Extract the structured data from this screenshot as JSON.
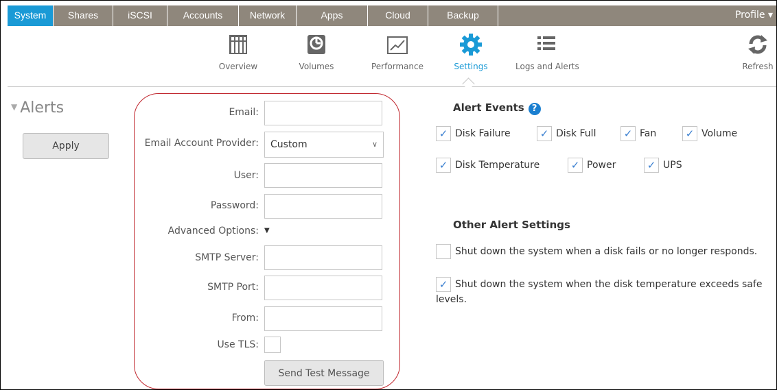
{
  "topnav": {
    "tabs": [
      {
        "label": "System",
        "active": true
      },
      {
        "label": "Shares"
      },
      {
        "label": "iSCSI"
      },
      {
        "label": "Accounts"
      },
      {
        "label": "Network"
      },
      {
        "label": "Apps"
      },
      {
        "label": "Cloud"
      },
      {
        "label": "Backup"
      }
    ],
    "profile": "Profile ▾"
  },
  "subnav": {
    "items": [
      {
        "label": "Overview",
        "icon": "overview-icon"
      },
      {
        "label": "Volumes",
        "icon": "volumes-icon"
      },
      {
        "label": "Performance",
        "icon": "performance-icon"
      },
      {
        "label": "Settings",
        "icon": "settings-icon",
        "active": true
      },
      {
        "label": "Logs and Alerts",
        "icon": "logs-icon"
      }
    ],
    "refresh": "Refresh"
  },
  "section": {
    "title": "Alerts",
    "apply": "Apply"
  },
  "form": {
    "email_label": "Email:",
    "email_value": "",
    "provider_label": "Email Account Provider:",
    "provider_value": "Custom",
    "user_label": "User:",
    "password_label": "Password:",
    "advanced_label": "Advanced Options:",
    "advanced_arrow": "▼",
    "smtp_server_label": "SMTP Server:",
    "smtp_port_label": "SMTP Port:",
    "from_label": "From:",
    "tls_label": "Use TLS:",
    "send_button": "Send Test Message"
  },
  "alert_events": {
    "title": "Alert Events",
    "help": "?",
    "items": [
      {
        "label": "Disk Failure",
        "checked": true
      },
      {
        "label": "Disk Full",
        "checked": true
      },
      {
        "label": "Fan",
        "checked": true
      },
      {
        "label": "Volume",
        "checked": true
      },
      {
        "label": "Disk Temperature",
        "checked": true
      },
      {
        "label": "Power",
        "checked": true
      },
      {
        "label": "UPS",
        "checked": true
      }
    ]
  },
  "other_settings": {
    "title": "Other Alert Settings",
    "shutdown_disk_fail": {
      "label": "Shut down the system when a disk fails or no longer responds.",
      "checked": false
    },
    "shutdown_temp": {
      "label": "Shut down the system when the disk temperature exceeds safe levels.",
      "checked": true
    }
  },
  "colors": {
    "accent": "#1a9ad6",
    "nav_bg": "#8f877c",
    "outline": "#c0262d"
  }
}
